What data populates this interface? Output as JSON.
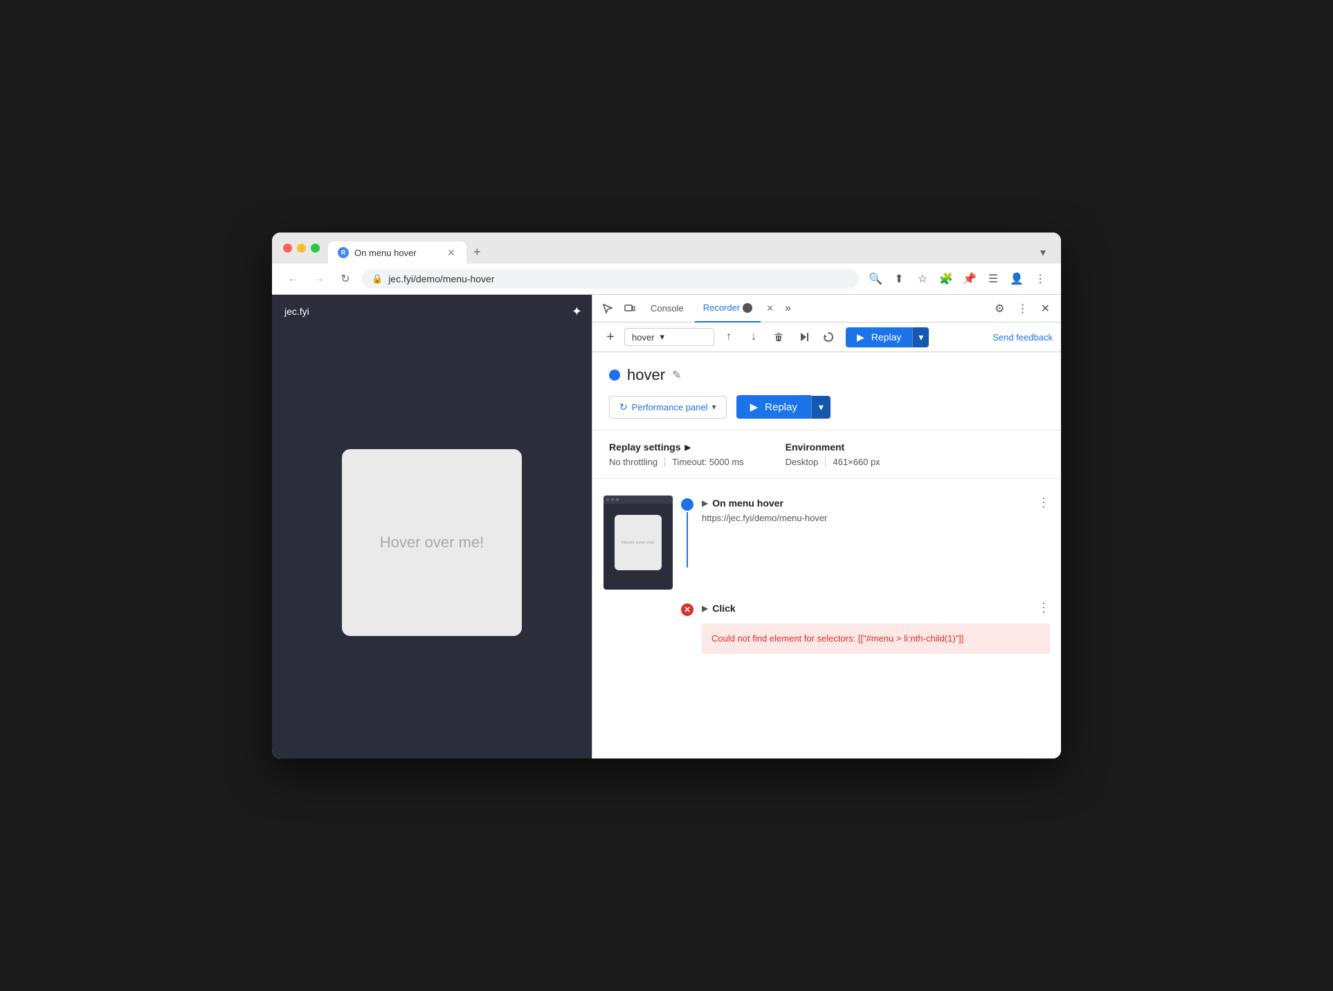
{
  "browser": {
    "tab_title": "On menu hover",
    "url": "jec.fyi/demo/menu-hover",
    "favicon_label": "R"
  },
  "traffic_lights": {
    "red": "#ff5f57",
    "yellow": "#febc2e",
    "green": "#28c840"
  },
  "nav": {
    "back_label": "←",
    "forward_label": "→",
    "reload_label": "↻"
  },
  "devtools": {
    "tabs": [
      {
        "id": "console",
        "label": "Console",
        "active": false
      },
      {
        "id": "recorder",
        "label": "Recorder",
        "active": true
      }
    ],
    "more_label": "»",
    "close_label": "✕",
    "settings_icon": "⚙",
    "kebab_icon": "⋮"
  },
  "toolbar": {
    "add_icon": "+",
    "recording_name": "hover",
    "dropdown_arrow": "▾",
    "export_icon": "↑",
    "import_icon": "↓",
    "delete_icon": "🗑",
    "play_step_icon": "▶|",
    "replay_dropdown_icon": "↩",
    "replay_label": "▶  Replay",
    "replay_dropdown_arrow": "▾",
    "send_feedback_label": "Send feedback"
  },
  "recording": {
    "dot_color": "#1a73e8",
    "name": "hover",
    "edit_icon": "✎"
  },
  "performance_panel": {
    "icon": "↻",
    "label": "Performance panel",
    "dropdown_arrow": "▾"
  },
  "replay_settings": {
    "title": "Replay settings",
    "expand_icon": "▶",
    "throttling_label": "No throttling",
    "timeout_label": "Timeout: 5000 ms"
  },
  "environment": {
    "title": "Environment",
    "device_label": "Desktop",
    "resolution_label": "461×660 px"
  },
  "browser_panel": {
    "site_label": "jec.fyi",
    "sun_icon": "✦",
    "demo_card_text": "Hover over me!"
  },
  "steps": [
    {
      "id": "step1",
      "title": "On menu hover",
      "url": "https://jec.fyi/demo/menu-hover",
      "dot_type": "blue",
      "expanded": true
    },
    {
      "id": "step2",
      "title": "Click",
      "dot_type": "red",
      "error": "Could not find element for selectors: [[\"#menu > li:nth-child(1)\"]]"
    }
  ]
}
